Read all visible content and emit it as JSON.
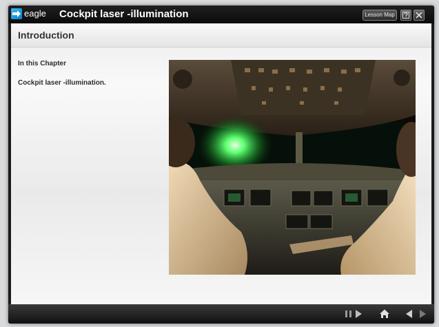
{
  "app": {
    "logo_text": "eagle",
    "title": "Cockpit laser -illumination"
  },
  "toolbar": {
    "lesson_map_label": "Lesson Map"
  },
  "page": {
    "title": "Introduction",
    "chapter_heading": "In this Chapter",
    "chapter_items": [
      "Cockpit laser -illumination."
    ]
  },
  "icons": {
    "help": "help-icon",
    "close": "close-icon",
    "pause": "pause-icon",
    "play": "play-icon",
    "home": "home-icon",
    "back": "back-arrow-icon",
    "forward": "forward-arrow-icon"
  },
  "colors": {
    "logo_accent": "#1a9ee0",
    "laser_glow": "#5dff70"
  }
}
